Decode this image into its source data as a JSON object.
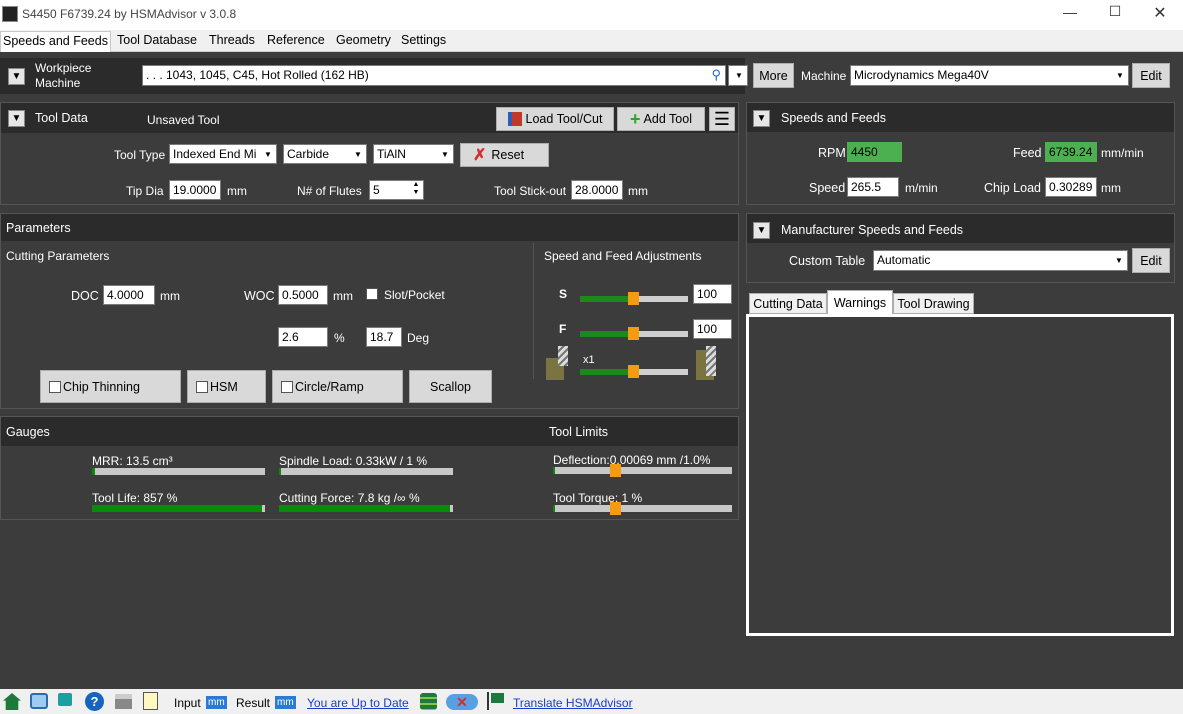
{
  "window": {
    "title": "S4450 F6739.24 by HSMAdvisor v 3.0.8",
    "controls": [
      "—",
      "☐",
      "✕"
    ]
  },
  "menu": {
    "tabs": [
      "Speeds and Feeds",
      "Tool Database",
      "Threads",
      "Reference",
      "Geometry",
      "Settings"
    ],
    "active": "Speeds and Feeds"
  },
  "workpiece": {
    "label_line1": "Workpiece",
    "label_line2": "Machine",
    "material": ". . . 1043, 1045, C45, Hot Rolled  (162 HB)",
    "more_label": "More",
    "machine_label": "Machine",
    "machine_value": "Microdynamics Mega40V",
    "edit_label": "Edit"
  },
  "tool_data": {
    "title": "Tool Data",
    "tool_name": "Unsaved Tool",
    "load_label": "Load Tool/Cut",
    "add_label": "Add Tool",
    "tool_type_label": "Tool Type",
    "tool_type": "Indexed End Mi",
    "material": "Carbide",
    "coating": "TiAlN",
    "reset_label": "Reset",
    "tip_dia_label": "Tip Dia",
    "tip_dia": "19.0000",
    "tip_dia_unit": "mm",
    "flutes_label": "N# of Flutes",
    "flutes": "5",
    "stickout_label": "Tool Stick-out",
    "stickout": "28.0000",
    "stickout_unit": "mm"
  },
  "parameters": {
    "title": "Parameters",
    "cutting_title": "Cutting Parameters",
    "doc_label": "DOC",
    "doc": "4.0000",
    "doc_unit": "mm",
    "woc_label": "WOC",
    "woc": "0.5000",
    "woc_unit": "mm",
    "slot_label": "Slot/Pocket",
    "woc_percent": "2.6",
    "percent_unit": "%",
    "angle": "18.7",
    "angle_unit": "Deg",
    "chip_thinning": "Chip Thinning",
    "hsm": "HSM",
    "circle_ramp": "Circle/Ramp",
    "scallop": "Scallop",
    "adjust_title": "Speed and Feed Adjustments",
    "s_label": "S",
    "s_value": "100",
    "s_level": 0.5,
    "f_label": "F",
    "f_value": "100",
    "f_level": 0.5,
    "x1_label": "x1",
    "x1_level": 0.5
  },
  "gauges": {
    "title": "Gauges",
    "limits_title": "Tool Limits",
    "mrr_label": "MRR: 13.5 cm³",
    "mrr_level": 0.02,
    "spindle_label": "Spindle Load: 0.33kW / 1 %",
    "spindle_level": 0.01,
    "life_label": "Tool Life: 857 %",
    "life_level": 0.98,
    "force_label": "Cutting Force: 7.8 kg /∞ %",
    "force_level": 0.98,
    "deflection_label": "Deflection:0.00069 mm /1.0%",
    "deflection_level": 0.01,
    "torque_label": "Tool Torque: 1 %",
    "torque_level": 0.01
  },
  "speeds": {
    "title": "Speeds and Feeds",
    "rpm_label": "RPM",
    "rpm": "4450",
    "feed_label": "Feed",
    "feed": "6739.24",
    "feed_unit": "mm/min",
    "speed_label": "Speed",
    "speed": "265.5",
    "speed_unit": "m/min",
    "chipload_label": "Chip Load",
    "chipload": "0.30289",
    "chipload_unit": "mm"
  },
  "manufacturer": {
    "title": "Manufacturer Speeds and Feeds",
    "custom_label": "Custom Table",
    "custom_value": "Automatic",
    "edit_label": "Edit"
  },
  "result_tabs": {
    "tabs": [
      "Cutting Data",
      "Warnings",
      "Tool Drawing"
    ],
    "active": "Warnings"
  },
  "status": {
    "input_label": "Input",
    "input_unit": "mm",
    "result_label": "Result",
    "result_unit": "mm",
    "update_link": "You are Up to Date",
    "translate_link": "Translate HSMAdvisor"
  }
}
